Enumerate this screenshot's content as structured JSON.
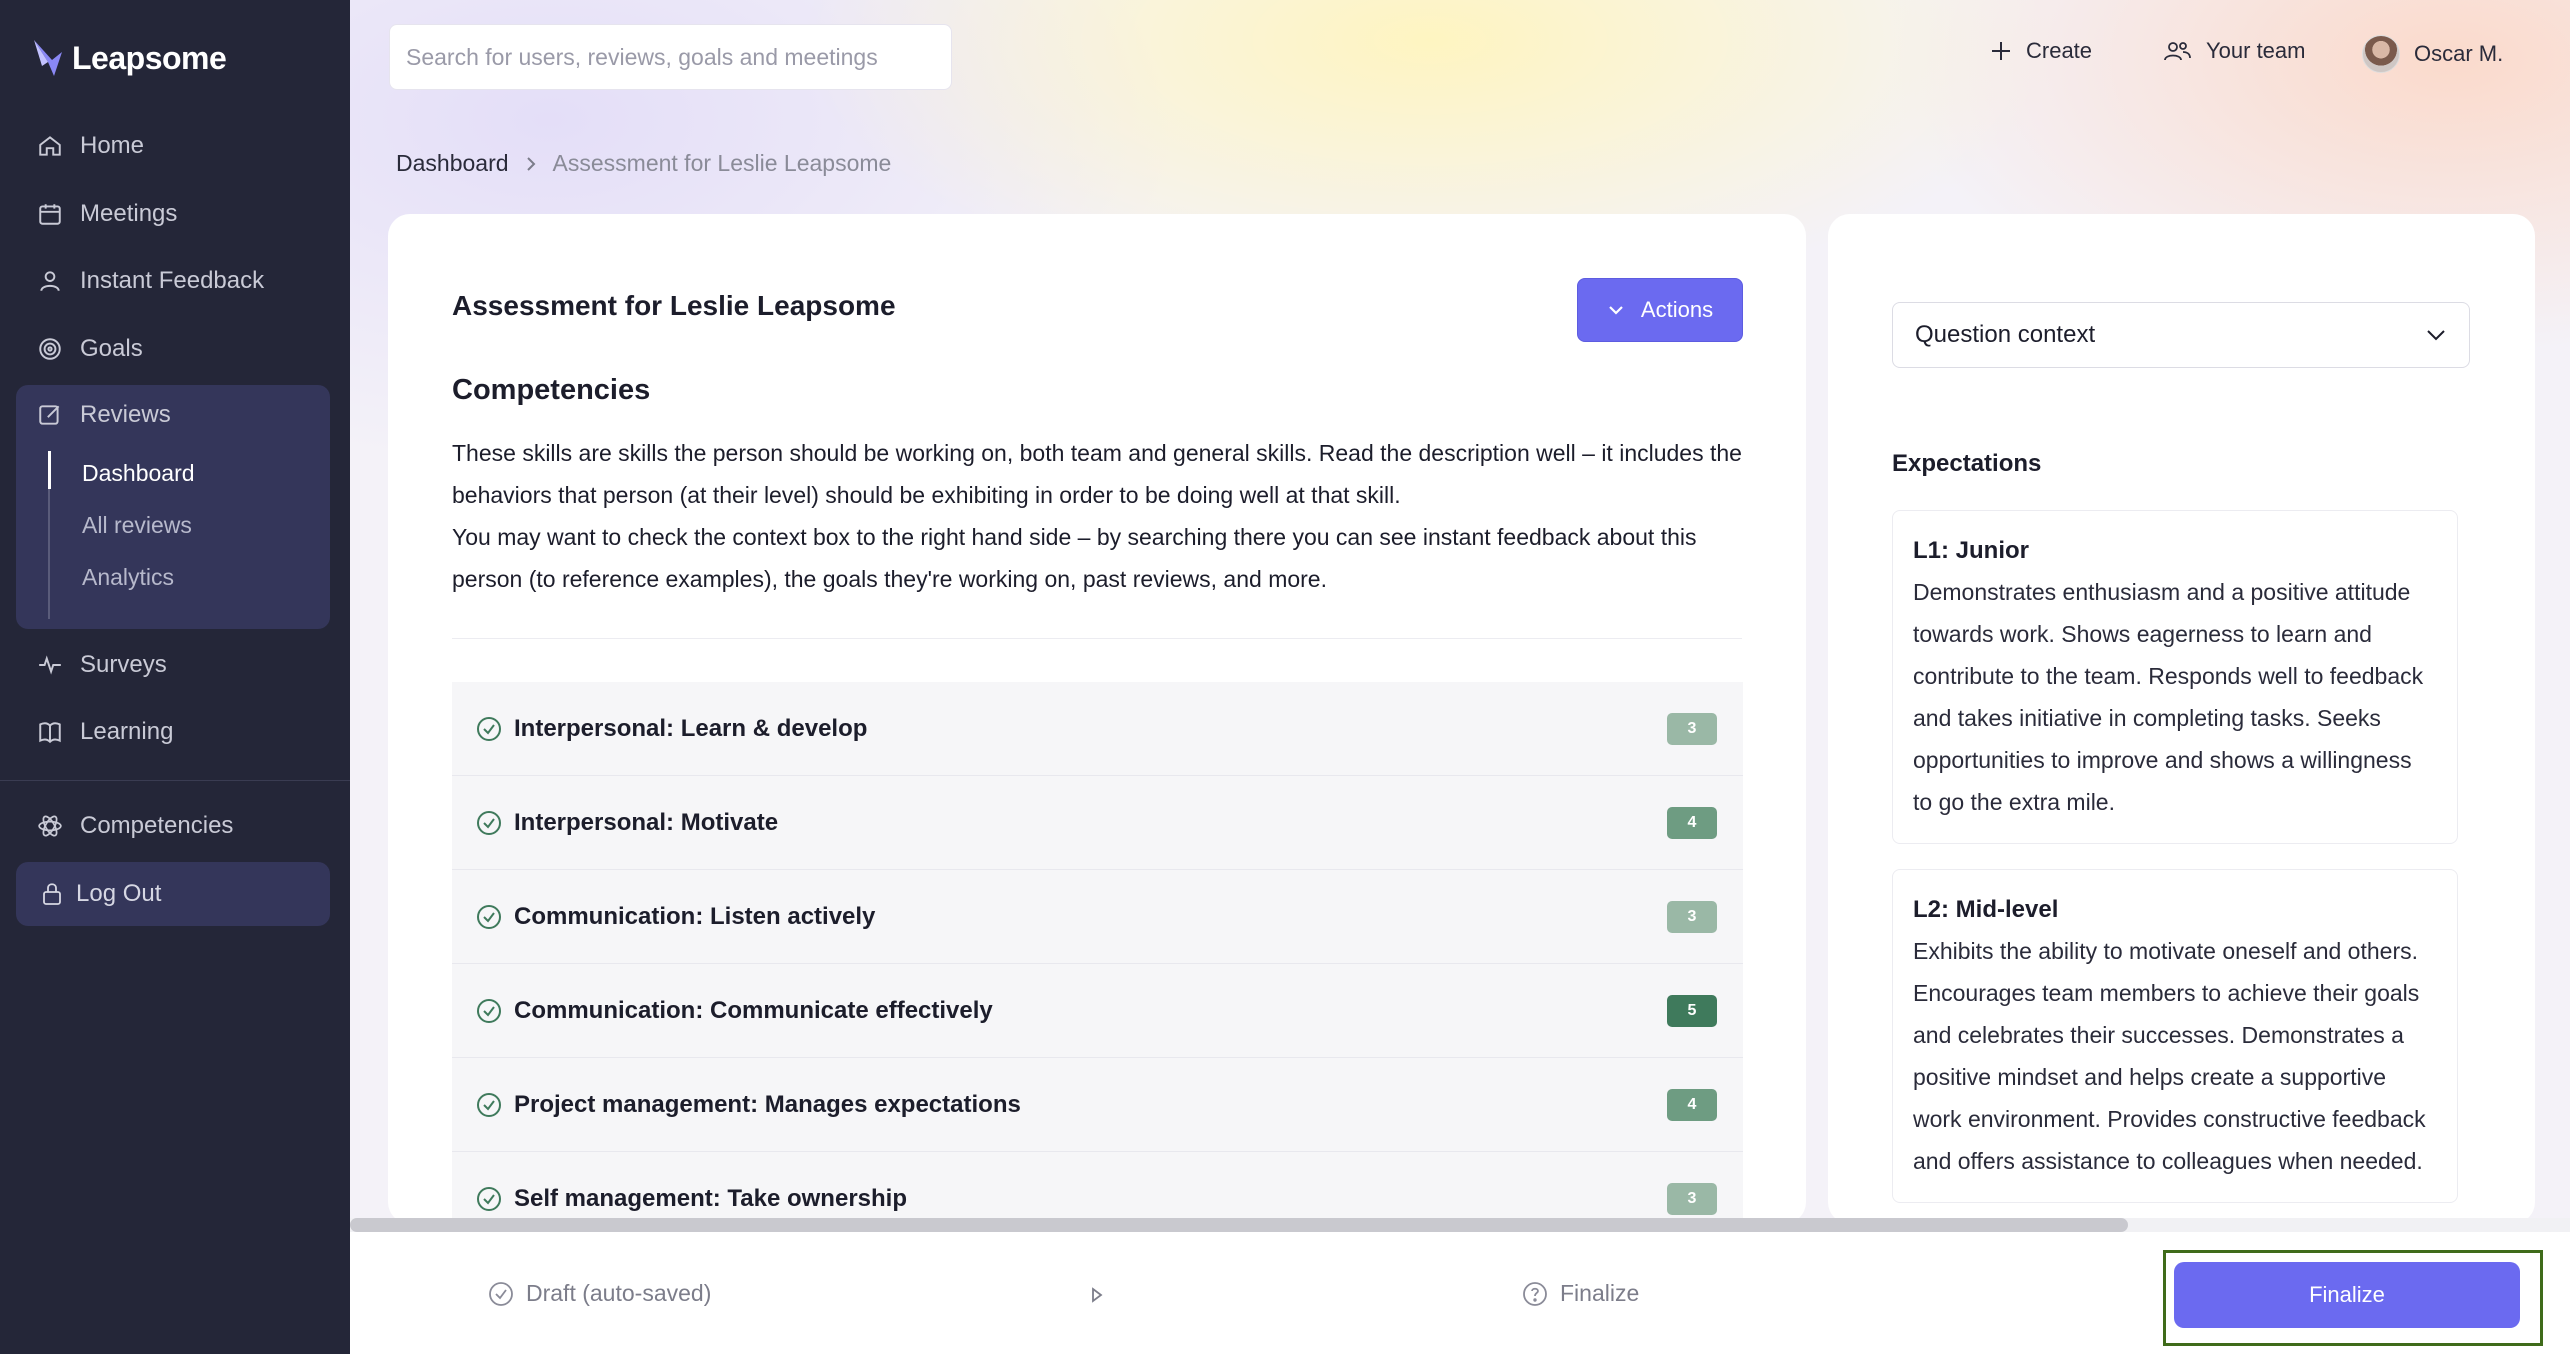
{
  "brand": {
    "name": "Leapsome"
  },
  "sidebar": {
    "items": [
      {
        "label": "Home",
        "icon": "home-icon"
      },
      {
        "label": "Meetings",
        "icon": "calendar-icon"
      },
      {
        "label": "Instant Feedback",
        "icon": "feedback-icon"
      },
      {
        "label": "Goals",
        "icon": "target-icon"
      },
      {
        "label": "Reviews",
        "icon": "edit-icon"
      },
      {
        "label": "Surveys",
        "icon": "pulse-icon"
      },
      {
        "label": "Learning",
        "icon": "book-icon"
      },
      {
        "label": "Competencies",
        "icon": "atom-icon"
      }
    ],
    "reviews_sub": [
      {
        "label": "Dashboard",
        "active": true
      },
      {
        "label": "All reviews",
        "active": false
      },
      {
        "label": "Analytics",
        "active": false
      }
    ],
    "logout_label": "Log Out"
  },
  "topbar": {
    "search_placeholder": "Search for users, reviews, goals and meetings",
    "create_label": "Create",
    "team_label": "Your team",
    "user_name": "Oscar M."
  },
  "breadcrumb": {
    "root": "Dashboard",
    "current": "Assessment for Leslie Leapsome"
  },
  "assessment": {
    "title": "Assessment for Leslie Leapsome",
    "actions_label": "Actions",
    "section_title": "Competencies",
    "description_p1": "These skills are skills the person should be working on, both team and general skills. Read the description well – it includes the behaviors that person (at their level) should be exhibiting in order to be doing well at that skill.",
    "description_p2": "You may want to check the context box to the right hand side – by searching there you can see instant feedback about this person (to reference examples), the goals they're working on, past reviews, and more.",
    "competencies": [
      {
        "label": "Interpersonal: Learn & develop",
        "score": "3"
      },
      {
        "label": "Interpersonal: Motivate",
        "score": "4"
      },
      {
        "label": "Communication: Listen actively",
        "score": "3"
      },
      {
        "label": "Communication: Communicate effectively",
        "score": "5"
      },
      {
        "label": "Project management: Manages expectations",
        "score": "4"
      },
      {
        "label": "Self management: Take ownership",
        "score": "3"
      }
    ],
    "score_colors": {
      "3": "#9ab8a6",
      "4": "#6e9c82",
      "5": "#3f7a5c"
    }
  },
  "context": {
    "select_value": "Question context",
    "expectations_title": "Expectations",
    "levels": [
      {
        "level": "L1: Junior",
        "text": "Demonstrates enthusiasm and a positive attitude towards work. Shows eagerness to learn and contribute to the team. Responds well to feedback and takes initiative in completing tasks. Seeks opportunities to improve and shows a willingness to go the extra mile."
      },
      {
        "level": "L2: Mid-level",
        "text": "Exhibits the ability to motivate oneself and others. Encourages team members to achieve their goals and celebrates their successes. Demonstrates a positive mindset and helps create a supportive work environment. Provides constructive feedback and offers assistance to colleagues when needed."
      }
    ]
  },
  "footer": {
    "draft_label": "Draft (auto-saved)",
    "finalize_step_label": "Finalize",
    "finalize_button": "Finalize"
  },
  "colors": {
    "accent": "#6b6af0",
    "sidebar_bg": "#242638",
    "check_green": "#3f7a5c"
  }
}
